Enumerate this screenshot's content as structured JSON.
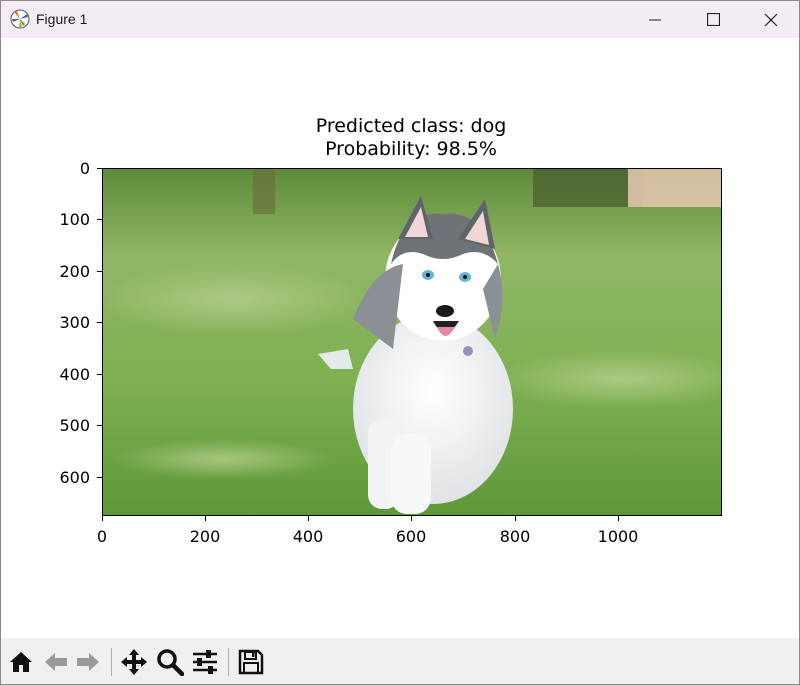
{
  "window": {
    "title": "Figure 1",
    "controls": {
      "minimize": "minimize",
      "maximize": "maximize",
      "close": "close"
    }
  },
  "plot": {
    "title_line1": "Predicted class: dog",
    "title_line2": "Probability: 98.5%",
    "yticks": [
      "0",
      "100",
      "200",
      "300",
      "400",
      "500",
      "600"
    ],
    "xticks": [
      "0",
      "200",
      "400",
      "600",
      "800",
      "1000"
    ],
    "image_content": "husky dog running on grass"
  },
  "toolbar": {
    "tools": [
      "home-icon",
      "back-icon",
      "forward-icon",
      "pan-icon",
      "zoom-icon",
      "configure-subplots-icon",
      "save-icon"
    ]
  },
  "colors": {
    "titlebar_bg": "#f4ecf4",
    "toolbar_bg": "#f0f0f0",
    "grass": "#6ea447"
  }
}
